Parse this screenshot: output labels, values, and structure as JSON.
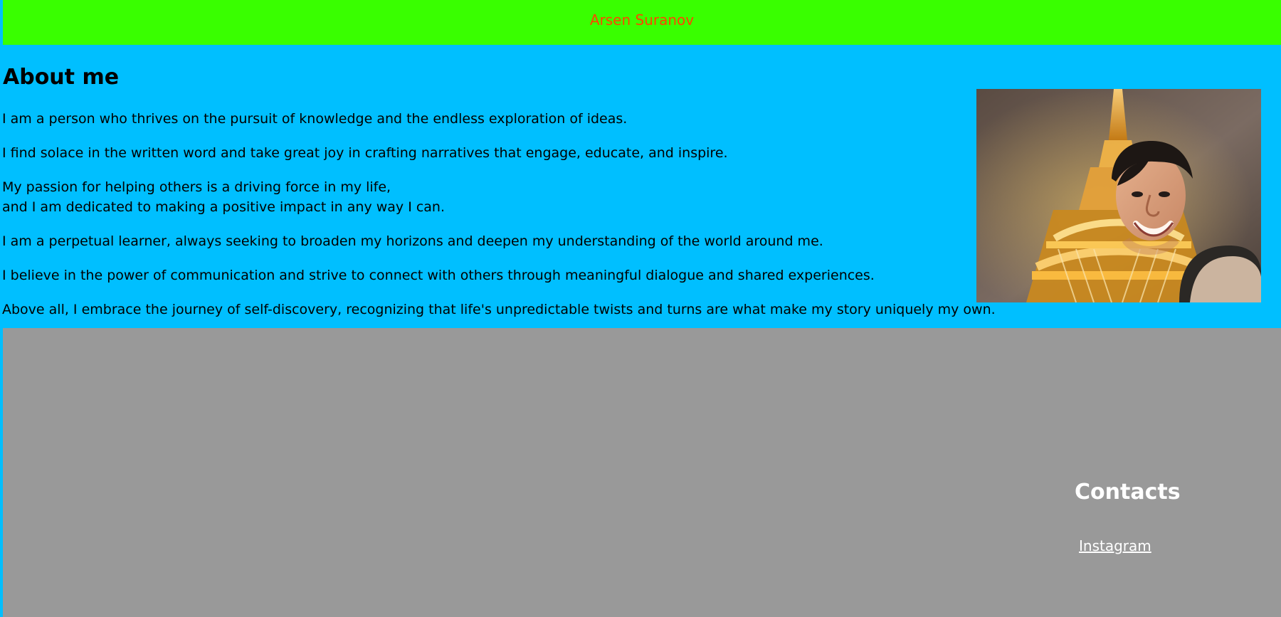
{
  "header": {
    "name": "Arsen Suranov"
  },
  "about": {
    "title": "About me",
    "paragraphs": [
      "I am a person who thrives on the pursuit of knowledge and the endless exploration of ideas.",
      "I find solace in the written word and take great joy in crafting narratives that engage, educate, and inspire.",
      "My passion for helping others is a driving force in my life,",
      "and I am dedicated to making a positive impact in any way I can.",
      "I am a perpetual learner, always seeking to broaden my horizons and deepen my understanding of the world around me.",
      "I believe in the power of communication and strive to connect with others through meaningful dialogue and shared experiences.",
      "Above all, I embrace the journey of self-discovery, recognizing that life's unpredictable twists and turns are what make my story uniquely my own."
    ]
  },
  "contacts": {
    "title": "Contacts",
    "link_label": "Instagram"
  },
  "colors": {
    "page_background": "#00bfff",
    "header_background": "#39ff00",
    "header_text": "#ff4500",
    "footer_background": "#999999",
    "footer_text": "#ffffff"
  }
}
